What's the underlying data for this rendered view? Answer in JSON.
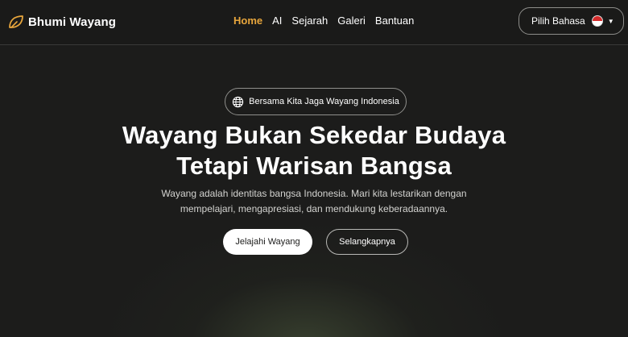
{
  "navbar": {
    "brand_name": "Bhumi Wayang",
    "brand_icon": "leaf-icon",
    "links": [
      {
        "label": "Home",
        "active": true
      },
      {
        "label": "AI",
        "active": false
      },
      {
        "label": "Sejarah",
        "active": false
      },
      {
        "label": "Galeri",
        "active": false
      },
      {
        "label": "Bantuan",
        "active": false
      }
    ],
    "language_button": {
      "label": "Pilih Bahasa",
      "flag": "indonesia-flag-icon"
    }
  },
  "hero": {
    "badge": {
      "icon": "globe-icon",
      "label": "Bersama Kita Jaga Wayang Indonesia"
    },
    "title_line1": "Wayang Bukan Sekedar Budaya",
    "title_line2": "Tetapi Warisan Bangsa",
    "subtitle_line1": "Wayang adalah identitas bangsa Indonesia. Mari kita lestarikan dengan",
    "subtitle_line2": "mempelajari, mengapresiasi, dan mendukung keberadaannya.",
    "primary_button": "Jelajahi Wayang",
    "secondary_button": "Selangkapnya"
  },
  "colors": {
    "accent": "#e8a63c",
    "background": "#1c1c1b",
    "text": "#ffffff"
  }
}
